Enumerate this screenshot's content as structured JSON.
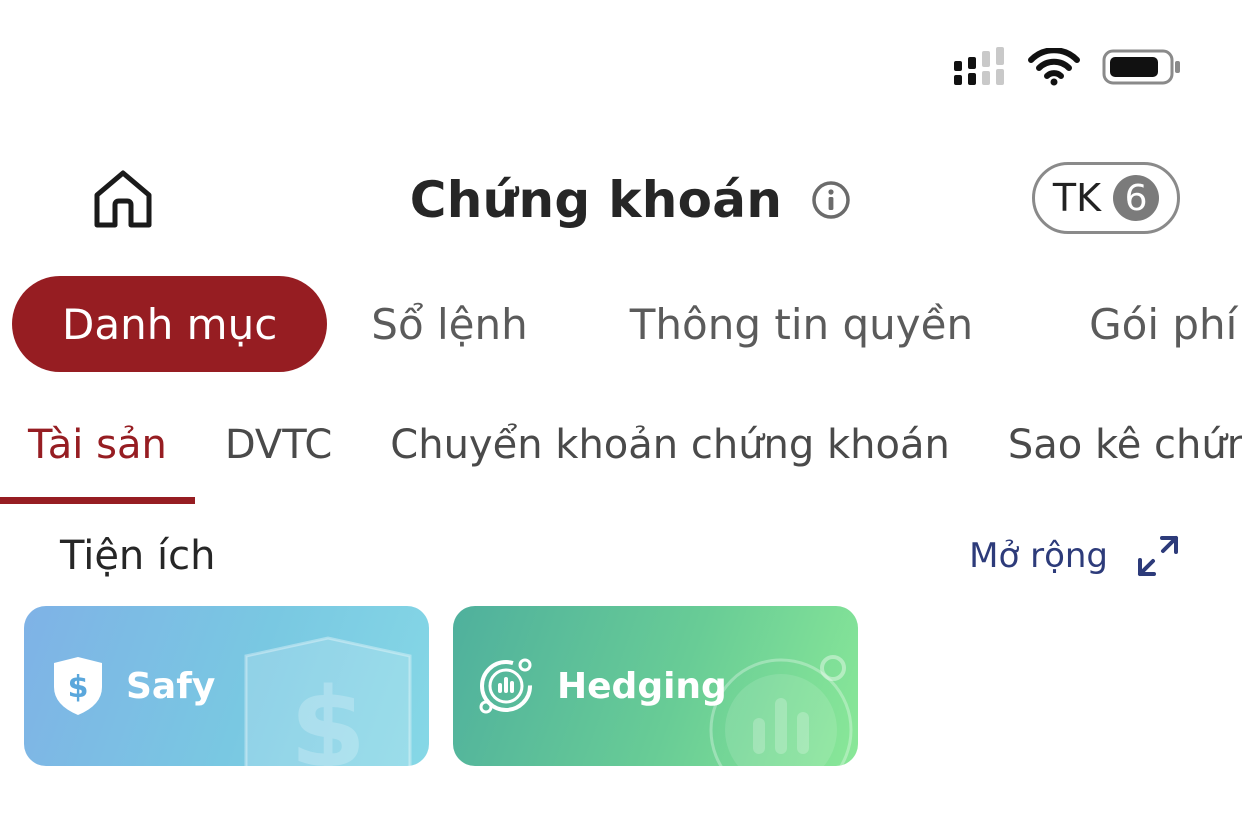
{
  "status_bar": {
    "signal_icon": "signal-bars-icon",
    "wifi_icon": "wifi-icon",
    "battery_icon": "battery-icon"
  },
  "header": {
    "home_icon": "home-icon",
    "title": "Chứng khoán",
    "info_icon": "info-icon",
    "account_label": "TK",
    "account_count": "6"
  },
  "main_tabs": [
    {
      "label": "Danh mục",
      "active": true
    },
    {
      "label": "Sổ lệnh",
      "active": false
    },
    {
      "label": "Thông tin quyền",
      "active": false
    },
    {
      "label": "Gói phí ưu",
      "active": false
    }
  ],
  "sub_tabs": [
    {
      "label": "Tài sản",
      "active": true
    },
    {
      "label": "DVTC",
      "active": false
    },
    {
      "label": "Chuyển khoản chứng khoán",
      "active": false
    },
    {
      "label": "Sao kê chứn",
      "active": false
    }
  ],
  "utilities": {
    "title": "Tiện ích",
    "expand_label": "Mở rộng",
    "expand_icon": "expand-arrows-icon",
    "cards": [
      {
        "label": "Safy",
        "icon": "shield-dollar-icon"
      },
      {
        "label": "Hedging",
        "icon": "hedging-chart-icon"
      }
    ]
  },
  "colors": {
    "brand_red": "#961d22",
    "link_blue": "#2d3b7a",
    "text_dark": "#262626",
    "text_muted": "#5b5b5b"
  }
}
